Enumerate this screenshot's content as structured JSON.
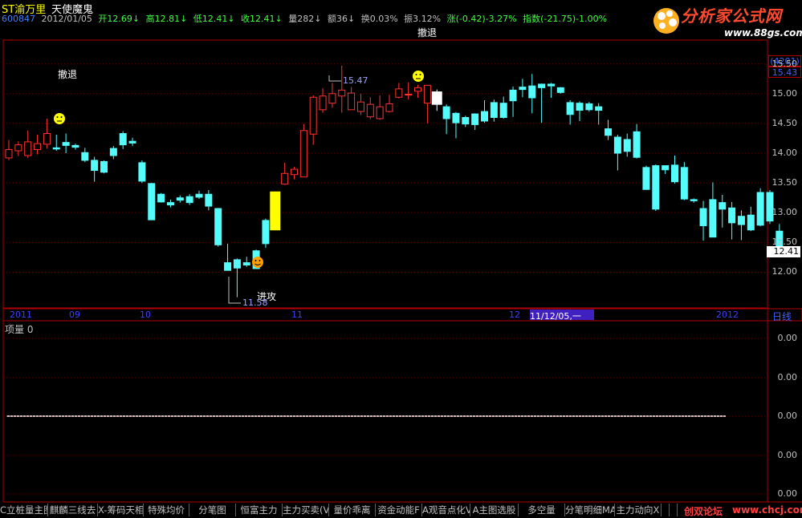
{
  "header": {
    "stock_name": "ST渝万里",
    "formula_name": "天使魔鬼",
    "code": "600847",
    "date": "2012/01/05",
    "open": "开12.69↓",
    "high": "高12.81↓",
    "low": "低12.41↓",
    "close": "收12.41↓",
    "volume": "量282↓",
    "amount": "额36↓",
    "turnover": "换0.03%",
    "amplitude": "振3.12%",
    "change": "涨(-0.42)-3.27%",
    "index": "指数(-21.75)-1.00%"
  },
  "logo": {
    "main": "分析家公式网",
    "url": "www.88gs.com"
  },
  "yaxis": {
    "top_box": "(4201)",
    "price_box": "15.43",
    "labels": [
      "15.50",
      "15.00",
      "14.50",
      "14.00",
      "13.50",
      "13.00",
      "12.50",
      "12.00"
    ],
    "current_price": "12.41"
  },
  "annotations": {
    "retreat_label_1": "撤退",
    "retreat_label_2": "撤退",
    "attack_label": "进攻",
    "high_marker": "15.47",
    "low_marker": "11.58"
  },
  "time_axis": {
    "labels": [
      "2011",
      "09",
      "10",
      "11",
      "12",
      "2012"
    ],
    "cursor": "11/12/05,一",
    "period": "日线"
  },
  "sub_chart": {
    "title": "项量 0",
    "ylabels": [
      "0.00",
      "0.00",
      "0.00",
      "0.00",
      "0.00",
      "0.00"
    ]
  },
  "tabs": [
    "C立桩量主图",
    "麒麟三线去",
    "X-筹码天相",
    "特殊均价",
    "分笔图",
    "恒富主力",
    "主力买卖(V",
    "量价乖离",
    "资金动能F",
    "A观音点化V",
    "A主图选股",
    "多空量",
    "分笔明细MA",
    "主力动向X",
    "",
    "",
    ""
  ],
  "footer": {
    "link": "创双论坛",
    "url": "www.chcj.com"
  },
  "colors": {
    "up": "#ff3232",
    "down": "#54fcfc",
    "signal_up": "#ffff00",
    "signal_down": "#ffffff",
    "axis": "#b00000"
  },
  "chart_data": {
    "type": "candlestick",
    "ylim": [
      11.4,
      15.9
    ],
    "candles": [
      {
        "o": 13.92,
        "h": 14.22,
        "l": 13.88,
        "c": 14.06
      },
      {
        "o": 14.04,
        "h": 14.2,
        "l": 13.95,
        "c": 14.14
      },
      {
        "o": 13.96,
        "h": 14.38,
        "l": 13.92,
        "c": 14.19
      },
      {
        "o": 14.06,
        "h": 14.31,
        "l": 13.98,
        "c": 14.16
      },
      {
        "o": 14.15,
        "h": 14.58,
        "l": 14.08,
        "c": 14.33
      },
      {
        "o": 14.09,
        "h": 14.31,
        "l": 14.04,
        "c": 14.07
      },
      {
        "o": 14.18,
        "h": 14.33,
        "l": 14.0,
        "c": 14.13
      },
      {
        "o": 14.13,
        "h": 14.16,
        "l": 14.06,
        "c": 14.1
      },
      {
        "o": 14.01,
        "h": 14.09,
        "l": 13.85,
        "c": 13.88
      },
      {
        "o": 13.88,
        "h": 13.94,
        "l": 13.52,
        "c": 13.71
      },
      {
        "o": 13.86,
        "h": 13.88,
        "l": 13.66,
        "c": 13.68
      },
      {
        "o": 14.08,
        "h": 14.12,
        "l": 13.9,
        "c": 13.96
      },
      {
        "o": 14.33,
        "h": 14.37,
        "l": 14.07,
        "c": 14.14
      },
      {
        "o": 14.2,
        "h": 14.26,
        "l": 14.12,
        "c": 14.17
      },
      {
        "o": 13.84,
        "h": 13.88,
        "l": 13.5,
        "c": 13.53
      },
      {
        "o": 13.49,
        "h": 13.5,
        "l": 12.88,
        "c": 12.88
      },
      {
        "o": 13.31,
        "h": 13.33,
        "l": 13.17,
        "c": 13.18
      },
      {
        "o": 13.17,
        "h": 13.22,
        "l": 13.09,
        "c": 13.13
      },
      {
        "o": 13.25,
        "h": 13.29,
        "l": 13.17,
        "c": 13.21
      },
      {
        "o": 13.27,
        "h": 13.31,
        "l": 13.13,
        "c": 13.17
      },
      {
        "o": 13.31,
        "h": 13.37,
        "l": 13.23,
        "c": 13.26
      },
      {
        "o": 13.31,
        "h": 13.38,
        "l": 13.04,
        "c": 13.11
      },
      {
        "o": 13.07,
        "h": 13.08,
        "l": 12.43,
        "c": 12.46
      },
      {
        "o": 12.16,
        "h": 12.48,
        "l": 12.04,
        "c": 12.03
      },
      {
        "o": 12.21,
        "h": 12.23,
        "l": 11.58,
        "c": 12.07
      },
      {
        "o": 12.16,
        "h": 12.26,
        "l": 12.09,
        "c": 12.12
      },
      {
        "o": 12.36,
        "h": 12.38,
        "l": 12.08,
        "c": 12.06
      },
      {
        "o": 12.87,
        "h": 12.9,
        "l": 12.41,
        "c": 12.48
      },
      {
        "o": 12.71,
        "h": 13.35,
        "l": 12.71,
        "c": 13.35,
        "signal": "up"
      },
      {
        "o": 13.48,
        "h": 13.84,
        "l": 13.47,
        "c": 13.66
      },
      {
        "o": 13.64,
        "h": 13.77,
        "l": 13.56,
        "c": 13.73
      },
      {
        "o": 13.6,
        "h": 14.49,
        "l": 13.6,
        "c": 14.38
      },
      {
        "o": 14.32,
        "h": 14.97,
        "l": 14.14,
        "c": 14.94
      },
      {
        "o": 14.73,
        "h": 15.09,
        "l": 14.68,
        "c": 14.96
      },
      {
        "o": 14.84,
        "h": 15.18,
        "l": 14.76,
        "c": 15.0
      },
      {
        "o": 14.96,
        "h": 15.47,
        "l": 14.68,
        "c": 15.06
      },
      {
        "o": 14.73,
        "h": 15.11,
        "l": 14.74,
        "c": 15.01
      },
      {
        "o": 14.7,
        "h": 15.0,
        "l": 14.64,
        "c": 14.86
      },
      {
        "o": 14.61,
        "h": 14.94,
        "l": 14.57,
        "c": 14.82
      },
      {
        "o": 14.58,
        "h": 14.97,
        "l": 14.56,
        "c": 14.78
      },
      {
        "o": 14.7,
        "h": 14.98,
        "l": 14.68,
        "c": 14.83
      },
      {
        "o": 14.94,
        "h": 15.18,
        "l": 14.92,
        "c": 15.08
      },
      {
        "o": 14.98,
        "h": 15.19,
        "l": 14.9,
        "c": 14.99
      },
      {
        "o": 15.04,
        "h": 15.15,
        "l": 14.93,
        "c": 15.1
      },
      {
        "o": 14.84,
        "h": 15.08,
        "l": 14.5,
        "c": 15.14
      },
      {
        "o": 15.03,
        "h": 15.07,
        "l": 14.71,
        "c": 14.82,
        "signal": "down"
      },
      {
        "o": 14.78,
        "h": 14.82,
        "l": 14.32,
        "c": 14.58
      },
      {
        "o": 14.67,
        "h": 14.69,
        "l": 14.25,
        "c": 14.51
      },
      {
        "o": 14.6,
        "h": 14.63,
        "l": 14.44,
        "c": 14.49
      },
      {
        "o": 14.66,
        "h": 14.67,
        "l": 14.39,
        "c": 14.48
      },
      {
        "o": 14.7,
        "h": 14.89,
        "l": 14.51,
        "c": 14.54
      },
      {
        "o": 14.85,
        "h": 14.9,
        "l": 14.53,
        "c": 14.6
      },
      {
        "o": 14.84,
        "h": 14.95,
        "l": 14.58,
        "c": 14.6
      },
      {
        "o": 15.06,
        "h": 15.12,
        "l": 14.61,
        "c": 14.88
      },
      {
        "o": 15.11,
        "h": 15.25,
        "l": 14.94,
        "c": 15.07
      },
      {
        "o": 15.13,
        "h": 15.33,
        "l": 14.67,
        "c": 14.93
      },
      {
        "o": 15.16,
        "h": 15.17,
        "l": 14.51,
        "c": 15.1
      },
      {
        "o": 15.16,
        "h": 15.18,
        "l": 14.93,
        "c": 15.13
      },
      {
        "o": 15.1,
        "h": 15.11,
        "l": 15.0,
        "c": 15.02
      },
      {
        "o": 14.85,
        "h": 14.89,
        "l": 14.48,
        "c": 14.65
      },
      {
        "o": 14.84,
        "h": 14.87,
        "l": 14.54,
        "c": 14.72
      },
      {
        "o": 14.83,
        "h": 14.86,
        "l": 14.7,
        "c": 14.73
      },
      {
        "o": 14.78,
        "h": 14.84,
        "l": 14.48,
        "c": 14.72
      },
      {
        "o": 14.41,
        "h": 14.56,
        "l": 14.22,
        "c": 14.3
      },
      {
        "o": 14.27,
        "h": 14.31,
        "l": 13.71,
        "c": 14.0
      },
      {
        "o": 14.23,
        "h": 14.33,
        "l": 13.94,
        "c": 14.03
      },
      {
        "o": 14.36,
        "h": 14.49,
        "l": 13.91,
        "c": 13.93
      },
      {
        "o": 13.76,
        "h": 13.79,
        "l": 13.39,
        "c": 13.39
      },
      {
        "o": 13.79,
        "h": 13.81,
        "l": 13.03,
        "c": 13.06
      },
      {
        "o": 13.79,
        "h": 13.79,
        "l": 13.65,
        "c": 13.72
      },
      {
        "o": 13.8,
        "h": 13.96,
        "l": 13.49,
        "c": 13.52
      },
      {
        "o": 13.76,
        "h": 13.85,
        "l": 13.21,
        "c": 13.23
      },
      {
        "o": 13.22,
        "h": 13.24,
        "l": 13.17,
        "c": 13.2
      },
      {
        "o": 13.07,
        "h": 13.2,
        "l": 12.53,
        "c": 12.78
      },
      {
        "o": 13.22,
        "h": 13.51,
        "l": 12.76,
        "c": 12.59
      },
      {
        "o": 13.17,
        "h": 13.3,
        "l": 12.75,
        "c": 13.06
      },
      {
        "o": 13.08,
        "h": 13.18,
        "l": 12.55,
        "c": 12.83
      },
      {
        "o": 12.94,
        "h": 13.04,
        "l": 12.54,
        "c": 12.8
      },
      {
        "o": 12.96,
        "h": 13.1,
        "l": 12.69,
        "c": 12.71
      },
      {
        "o": 13.34,
        "h": 13.41,
        "l": 12.77,
        "c": 12.79
      },
      {
        "o": 13.34,
        "h": 13.38,
        "l": 12.81,
        "c": 12.86
      },
      {
        "o": 12.69,
        "h": 12.81,
        "l": 12.41,
        "c": 12.41
      }
    ]
  }
}
